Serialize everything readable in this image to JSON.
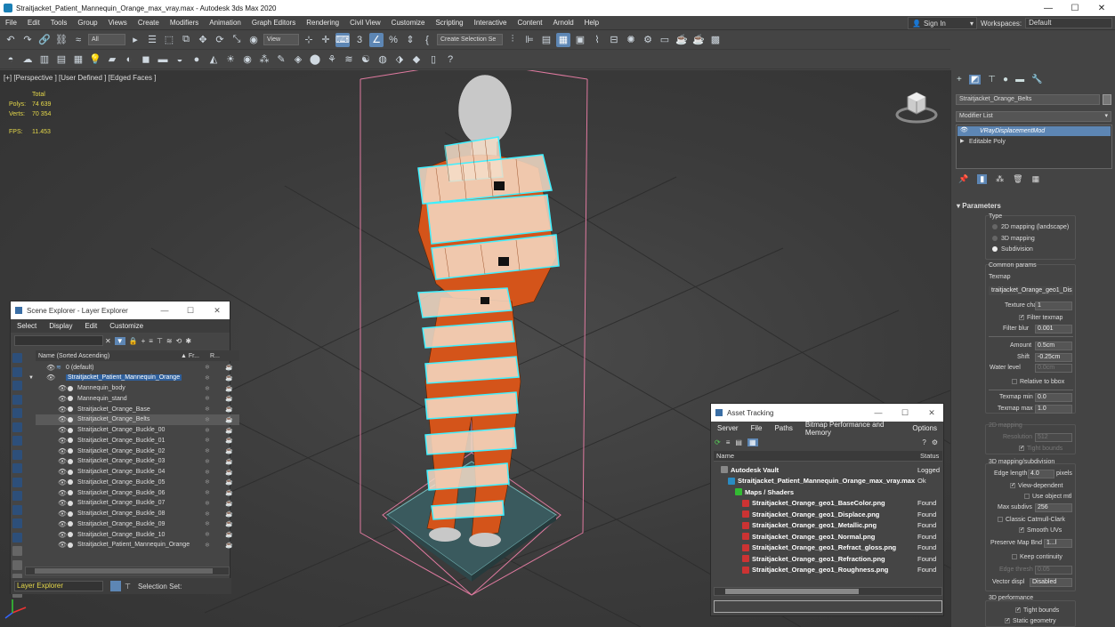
{
  "window": {
    "title": "Straitjacket_Patient_Mannequin_Orange_max_vray.max - Autodesk 3ds Max 2020",
    "minimize": "—",
    "maximize": "☐",
    "close": "✕"
  },
  "menubar": {
    "items": [
      "File",
      "Edit",
      "Tools",
      "Group",
      "Views",
      "Create",
      "Modifiers",
      "Animation",
      "Graph Editors",
      "Rendering",
      "Civil View",
      "Customize",
      "Scripting",
      "Interactive",
      "Content",
      "Arnold",
      "Help"
    ],
    "signin": "Sign In",
    "workspace_label": "Workspaces:",
    "workspace_value": "Default"
  },
  "toolbar1": {
    "filter_all": "All",
    "view_dropdown": "View",
    "selection_set": "Create Selection Se"
  },
  "viewport": {
    "label": "[+] [Perspective ] [User Defined ] [Edged Faces ]",
    "stats": {
      "total_label": "Total",
      "polys_label": "Polys:",
      "polys_value": "74 639",
      "verts_label": "Verts:",
      "verts_value": "70 354",
      "fps_label": "FPS:",
      "fps_value": "11.453"
    }
  },
  "scene_explorer": {
    "title": "Scene Explorer - Layer Explorer",
    "menu": [
      "Select",
      "Display",
      "Edit",
      "Customize"
    ],
    "col_name": "Name (Sorted Ascending)",
    "col_fr": "▲ Fr...",
    "col_r": "R...",
    "rows": [
      {
        "name": "0 (default)",
        "indent": 0
      },
      {
        "name": "Straitjacket_Patient_Mannequin_Orange",
        "indent": 0
      },
      {
        "name": "Mannequin_body",
        "indent": 1
      },
      {
        "name": "Mannequin_stand",
        "indent": 1
      },
      {
        "name": "Straitjacket_Orange_Base",
        "indent": 1
      },
      {
        "name": "Straitjacket_Orange_Belts",
        "indent": 1
      },
      {
        "name": "Straitjacket_Orange_Buckle_00",
        "indent": 1
      },
      {
        "name": "Straitjacket_Orange_Buckle_01",
        "indent": 1
      },
      {
        "name": "Straitjacket_Orange_Buckle_02",
        "indent": 1
      },
      {
        "name": "Straitjacket_Orange_Buckle_03",
        "indent": 1
      },
      {
        "name": "Straitjacket_Orange_Buckle_04",
        "indent": 1
      },
      {
        "name": "Straitjacket_Orange_Buckle_05",
        "indent": 1
      },
      {
        "name": "Straitjacket_Orange_Buckle_06",
        "indent": 1
      },
      {
        "name": "Straitjacket_Orange_Buckle_07",
        "indent": 1
      },
      {
        "name": "Straitjacket_Orange_Buckle_08",
        "indent": 1
      },
      {
        "name": "Straitjacket_Orange_Buckle_09",
        "indent": 1
      },
      {
        "name": "Straitjacket_Orange_Buckle_10",
        "indent": 1
      },
      {
        "name": "Straitjacket_Patient_Mannequin_Orange",
        "indent": 1
      }
    ],
    "footer_mode": "Layer Explorer",
    "selection_set_label": "Selection Set:"
  },
  "asset_tracking": {
    "title": "Asset Tracking",
    "menu": [
      "Server",
      "File",
      "Paths",
      "Bitmap Performance and Memory",
      "Options"
    ],
    "col_name": "Name",
    "col_status": "Status",
    "rows": [
      {
        "name": "Autodesk Vault",
        "status": "Logged",
        "indent": 1
      },
      {
        "name": "Straitjacket_Patient_Mannequin_Orange_max_vray.max",
        "status": "Ok",
        "indent": 2
      },
      {
        "name": "Maps / Shaders",
        "status": "",
        "indent": 3
      },
      {
        "name": "Straitjacket_Orange_geo1_BaseColor.png",
        "status": "Found",
        "indent": 4
      },
      {
        "name": "Straitjacket_Orange_geo1_Displace.png",
        "status": "Found",
        "indent": 4
      },
      {
        "name": "Straitjacket_Orange_geo1_Metallic.png",
        "status": "Found",
        "indent": 4
      },
      {
        "name": "Straitjacket_Orange_geo1_Normal.png",
        "status": "Found",
        "indent": 4
      },
      {
        "name": "Straitjacket_Orange_geo1_Refract_gloss.png",
        "status": "Found",
        "indent": 4
      },
      {
        "name": "Straitjacket_Orange_geo1_Refraction.png",
        "status": "Found",
        "indent": 4
      },
      {
        "name": "Straitjacket_Orange_geo1_Roughness.png",
        "status": "Found",
        "indent": 4
      }
    ]
  },
  "command_panel": {
    "object_name": "Straitjacket_Orange_Belts",
    "modifier_list": "Modifier List",
    "stack": [
      "VRayDisplacementMod",
      "Editable Poly"
    ],
    "rollout_title": "Parameters",
    "type_label": "Type",
    "type_options": [
      "2D mapping (landscape)",
      "3D mapping",
      "Subdivision"
    ],
    "type_selected": "Subdivision",
    "common_params": "Common params",
    "texmap_label": "Texmap",
    "texmap_value": "traitjacket_Orange_geo1_Dis",
    "texture_chan_label": "Texture chan",
    "texture_chan_value": "1",
    "filter_texmap": "Filter texmap",
    "filter_blur_label": "Filter blur",
    "filter_blur_value": "0.001",
    "amount_label": "Amount",
    "amount_value": "0.5cm",
    "shift_label": "Shift",
    "shift_value": "-0.25cm",
    "water_level_label": "Water level",
    "water_level_value": "0.0cm",
    "relative_to_bbox": "Relative to bbox",
    "texmap_min_label": "Texmap min",
    "texmap_min_value": "0.0",
    "texmap_max_label": "Texmap max",
    "texmap_max_value": "1.0",
    "mapping_2d": "2D mapping",
    "resolution_label": "Resolution",
    "resolution_value": "512",
    "tight_bounds_2d": "Tight bounds",
    "mapping_3d": "3D mapping/subdivision",
    "edge_length_label": "Edge length",
    "edge_length_value": "4.0",
    "edge_length_unit": "pixels",
    "view_dependent": "View-dependent",
    "use_object_mtl": "Use object mtl",
    "max_subdivs_label": "Max subdivs",
    "max_subdivs_value": "256",
    "classic_catmull": "Classic Catmull-Clark",
    "smooth_uvs": "Smooth UVs",
    "preserve_map_label": "Preserve Map Bnd",
    "preserve_map_value": "1...l",
    "keep_continuity": "Keep continuity",
    "edge_thresh_label": "Edge thresh",
    "edge_thresh_value": "0.05",
    "vector_displ_label": "Vector displ",
    "vector_displ_value": "Disabled",
    "performance_3d": "3D performance",
    "tight_bounds_3d": "Tight bounds",
    "static_geometry": "Static geometry"
  },
  "colors": {
    "selection_blue": "#2e5f9b",
    "stats_yellow": "#e5d84a",
    "wire_cyan": "#3ff0ff",
    "jacket_orange": "#d4541a"
  }
}
